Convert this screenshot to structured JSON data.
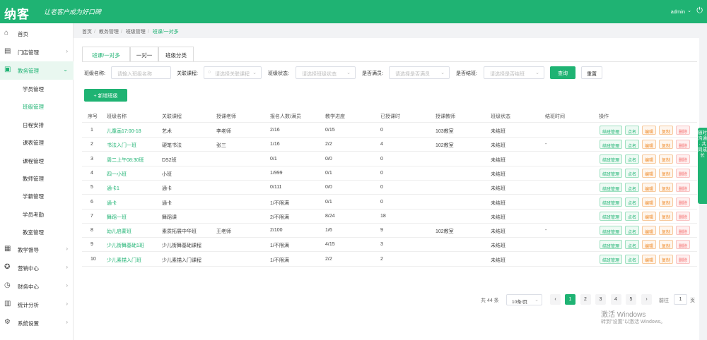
{
  "header": {
    "logo": "纳客",
    "slogan": "让老客户成为好口碑",
    "user": "admin",
    "arrow_icon": "chevron-down-icon",
    "power_icon": "power-icon",
    "bg": "#1fb373"
  },
  "sidebar": {
    "items": [
      {
        "icon": "⌂",
        "label": "首页",
        "arrow": ""
      },
      {
        "icon": "▤",
        "label": "门店管理",
        "arrow": "›"
      },
      {
        "icon": "▣",
        "label": "教务管理",
        "arrow": "⌄"
      },
      {
        "icon": "▦",
        "label": "教学督导",
        "arrow": "›"
      },
      {
        "icon": "✪",
        "label": "营销中心",
        "arrow": "›"
      },
      {
        "icon": "◷",
        "label": "财务中心",
        "arrow": "›"
      },
      {
        "icon": "▥",
        "label": "统计分析",
        "arrow": "›"
      },
      {
        "icon": "⚙",
        "label": "系统设置",
        "arrow": "›"
      }
    ],
    "subitems": [
      "学员管理",
      "班级管理",
      "日程安排",
      "课表管理",
      "课程管理",
      "教师管理",
      "学籍管理",
      "学员考勤",
      "教室管理"
    ]
  },
  "breadcrumb": [
    "首页",
    "教务管理",
    "班级管理",
    "班课/一对多"
  ],
  "tabs": [
    "班课/一对多",
    "一对一",
    "班级分类"
  ],
  "filters": [
    {
      "label": "班级名称:",
      "placeholder": "请输入班级名称"
    },
    {
      "label": "关联课程:",
      "placeholder": "请选择关联课程"
    },
    {
      "label": "班级状态:",
      "placeholder": "请选择班级状态"
    },
    {
      "label": "是否满员:",
      "placeholder": "请选择是否满员"
    },
    {
      "label": "是否结班:",
      "placeholder": "请选择是否结班"
    }
  ],
  "buttons": {
    "query": "查询",
    "reset": "重置",
    "add": "+ 新增班级"
  },
  "table": {
    "headers": [
      "序号",
      "班级名称",
      "关联课程",
      "授课老师",
      "报名人数/满员",
      "教学进度",
      "已授课时",
      "授课教师",
      "班级状态",
      "结班时间",
      "操作"
    ],
    "rows": [
      [
        "1",
        "儿童画17:00-18",
        "艺术",
        "李老师",
        "2/16",
        "0/15",
        "0",
        "103教室",
        "未结班",
        ""
      ],
      [
        "2",
        "书法入门一班",
        "硬笔书法",
        "张三",
        "1/16",
        "2/2",
        "4",
        "102教室",
        "未结班",
        "-"
      ],
      [
        "3",
        "周二上午08:30班",
        "DS2班",
        "",
        "0/1",
        "0/0",
        "0",
        "",
        "未结班",
        ""
      ],
      [
        "4",
        "四一小班",
        "小班",
        "",
        "1/999",
        "0/1",
        "0",
        "",
        "未结班",
        ""
      ],
      [
        "5",
        "通卡1",
        "通卡",
        "",
        "0/111",
        "0/0",
        "0",
        "",
        "未结班",
        ""
      ],
      [
        "6",
        "通卡",
        "通卡",
        "",
        "1/不限满",
        "0/1",
        "0",
        "",
        "未结班",
        ""
      ],
      [
        "7",
        "舞蹈一班",
        "舞蹈课",
        "",
        "2/不限满",
        "8/24",
        "18",
        "",
        "未结班",
        ""
      ],
      [
        "8",
        "幼儿启蒙班",
        "素质拓展中华班",
        "王老师",
        "2/100",
        "1/6",
        "9",
        "102教室",
        "未结班",
        "-"
      ],
      [
        "9",
        "少儿街舞基础1班",
        "少儿街舞基础课程",
        "",
        "1/不限满",
        "4/15",
        "3",
        "",
        "未结班",
        ""
      ],
      [
        "10",
        "少儿素描入门班",
        "少儿素描入门课程",
        "",
        "1/不限满",
        "2/2",
        "2",
        "",
        "未结班",
        ""
      ]
    ],
    "ops": [
      "结班管理",
      "点名",
      "编辑",
      "复制",
      "删除"
    ]
  },
  "pagination": {
    "total": "共 44 条",
    "page_size": "10条/页",
    "pages": [
      "1",
      "2",
      "3",
      "4",
      "5"
    ],
    "prev": "‹",
    "next": "›",
    "goto": "前往",
    "page_value": "1",
    "page_unit": "页"
  },
  "float_tab": "随时沟通 · 共同成长",
  "watermark": {
    "line1": "激活 Windows",
    "line2": "转到\"设置\"以激活 Windows。"
  }
}
